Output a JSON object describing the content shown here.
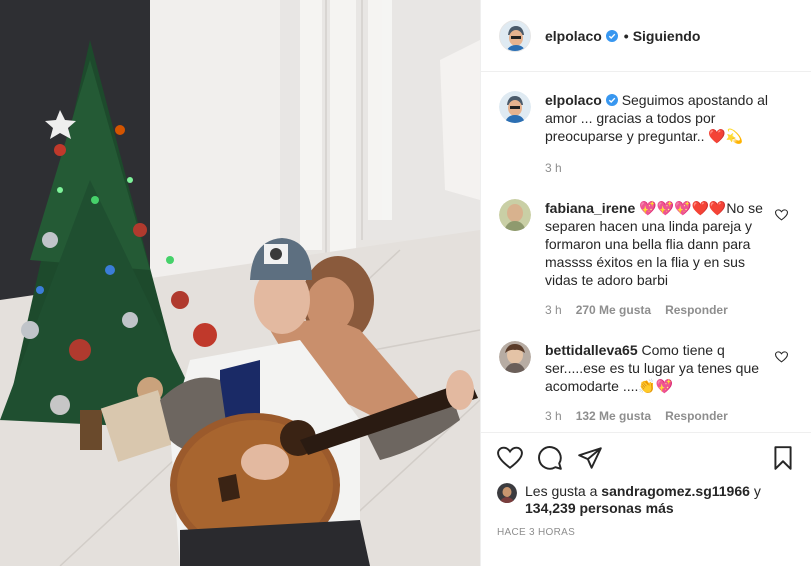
{
  "post_author": {
    "username": "elpolaco",
    "follow_status": "Siguiendo",
    "separator": "•"
  },
  "caption": {
    "username": "elpolaco",
    "text": "Seguimos apostando al amor ... gracias a todos por preocuparse y preguntar.. ❤️💫",
    "time": "3 h"
  },
  "comments": [
    {
      "username": "fabiana_irene",
      "text": "💖💖💖❤️❤️No se separen hacen una linda pareja y formaron una bella flia dann para massss éxitos en la flia y en sus vidas te adoro barbi",
      "time": "3 h",
      "likes": "270 Me gusta",
      "reply": "Responder"
    },
    {
      "username": "bettidalleva65",
      "text": "Como tiene q ser.....ese es tu lugar ya tenes que acomodarte ....👏💖",
      "time": "3 h",
      "likes": "132 Me gusta",
      "reply": "Responder"
    }
  ],
  "likes": {
    "prefix": "Les gusta a",
    "user": "sandragomez.sg11966",
    "joiner": "y",
    "count": "134,239 personas más"
  },
  "posted": "HACE 3 HORAS",
  "icons": {
    "like": "heart-icon",
    "comment": "comment-icon",
    "share": "share-icon",
    "save": "bookmark-icon",
    "verified": "verified-badge-icon"
  },
  "colors": {
    "verified": "#3897f0",
    "text": "#262626",
    "muted": "#8e8e8e",
    "border": "#efefef"
  }
}
